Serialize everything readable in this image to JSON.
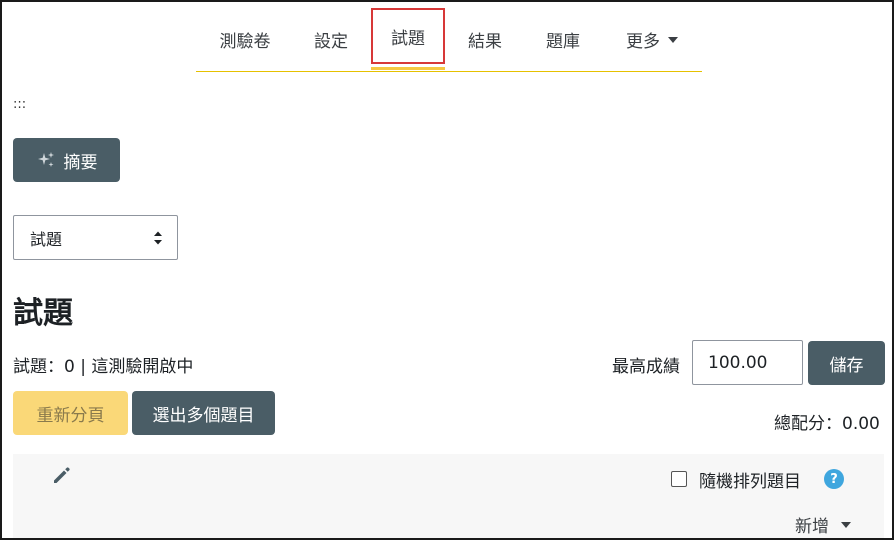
{
  "nav": {
    "tabs": [
      {
        "label": "測驗卷"
      },
      {
        "label": "設定"
      },
      {
        "label": "試題"
      },
      {
        "label": "結果"
      },
      {
        "label": "題庫"
      },
      {
        "label": "更多"
      }
    ],
    "active_tab": "試題"
  },
  "drag_handle": ":::",
  "summary_button": {
    "label": "摘要",
    "icon": "sparkle-icon"
  },
  "section_select": {
    "selected": "試題"
  },
  "page_title": "試題",
  "status_text": "試題：0 | 這測驗開啟中",
  "max_grade": {
    "label": "最高成績",
    "value": "100.00"
  },
  "save_label": "儲存",
  "repaginate_label": "重新分頁",
  "select_multiple_label": "選出多個題目",
  "total_marks": "總配分：0.00",
  "section": {
    "shuffle_label": "隨機排列題目",
    "shuffle_checked": false,
    "help_icon": "?",
    "add_label": "新增"
  },
  "colors": {
    "primary_button": "#4a5d66",
    "warning_button": "#fad878",
    "active_tab_outline": "#d73838",
    "nav_underline": "#e6c100",
    "help_icon": "#3fa6de"
  }
}
